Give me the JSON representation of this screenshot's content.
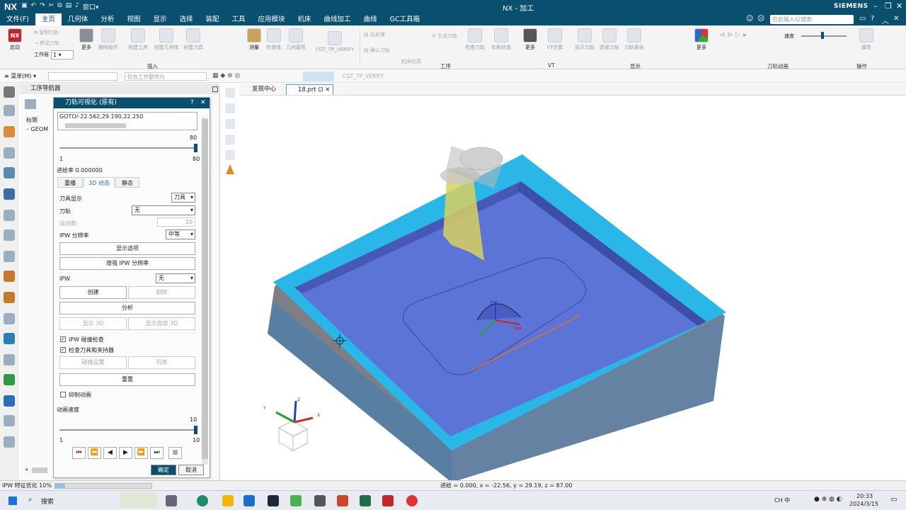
{
  "app": {
    "title": "NX - 加工",
    "logo": "NX",
    "brand": "SIEMENS",
    "quick_window": "窗口"
  },
  "menu": {
    "items": [
      "文件(F)",
      "主页",
      "几何体",
      "分析",
      "视图",
      "显示",
      "选择",
      "装配",
      "工具",
      "应用模块",
      "机床",
      "曲线加工",
      "曲线",
      "GC工具箱"
    ],
    "active": "主页",
    "search_placeholder": "在此输入以搜索"
  },
  "ribbon": {
    "start_label": "启动",
    "more_label": "更多",
    "workpiece_label": "工作层",
    "workpiece_value": "1",
    "insert_small": [
      "复制刀轨",
      "移动刀轨"
    ],
    "insert_buttons": [
      "删除组件",
      "创建工序",
      "创建几何体",
      "创建刀具",
      "测量",
      "检查体",
      "几何属性",
      "CGT_TP_VERIFY"
    ],
    "op_small": [
      "后处理",
      "确认刀轨",
      "机床仿真",
      "生成刀轨"
    ],
    "op_buttons": [
      "检查刀轨",
      "车削状态"
    ],
    "vt_label": "VT仿真",
    "display_buttons": [
      "显示刀轨",
      "选择刀轨",
      "刀轨报告"
    ],
    "speed_label": "速度",
    "property_label": "属性",
    "groups": [
      "插入",
      "工序",
      "VT",
      "显示",
      "刀轨动画",
      "操作"
    ]
  },
  "toolbar2": {
    "menu_label": "菜单(M)",
    "filter_placeholder": "仅在工作部件内",
    "verify_label": "CGT_TP_VERIFY"
  },
  "navigator": {
    "title": "工序导航器",
    "col_header": "标题",
    "root": "GEOM"
  },
  "dialog": {
    "title": "刀轨可视化 (原有)",
    "goto_line": "GOTO/-22.562,29.190,22.250",
    "slider_max": "80",
    "slider_min": "1",
    "slider_right": "80",
    "slider_value": 1.0,
    "feed_rate": "进给率 0.000000",
    "tabs": [
      "重播",
      "3D 动态",
      "静态"
    ],
    "active_tab": "3D 动态",
    "tool_display_label": "刀具显示",
    "tool_display_value": "刀具",
    "toolpath_label": "刀轨",
    "toolpath_value": "无",
    "motion_label": "运动数",
    "motion_value": "10",
    "ipw_res_label": "IPW 分辨率",
    "ipw_res_value": "中等",
    "btn_display_options": "显示选项",
    "btn_enhance_ipw": "增强 IPW 分辨率",
    "ipw_label": "IPW",
    "ipw_value": "无",
    "btn_create": "创建",
    "btn_delete": "删除",
    "btn_analyze": "分析",
    "btn_show3d": "显示 3D",
    "btn_show_custom3d": "显示自旋 3D",
    "cb_collision": "IPW 碰撞检查",
    "cb_check_tool": "检查刀具和夹持器",
    "btn_collision_settings": "碰撞设置",
    "btn_list": "列表",
    "btn_reset": "重置",
    "cb_suppress": "抑制动画",
    "anim_speed_label": "动画速度",
    "speed_max": "10",
    "speed_min": "1",
    "speed_right": "10",
    "speed_value": 1.0,
    "ok": "确定",
    "cancel": "取消"
  },
  "viewport": {
    "tabs": [
      "发现中心",
      "18.prt"
    ],
    "active_tab": "18.prt",
    "triad": {
      "x": "X",
      "y": "Y",
      "z": "Z"
    },
    "csys": {
      "zm": "ZM",
      "xm": "XM"
    }
  },
  "statusbar": {
    "left": "IPW 特征优化 10%",
    "right": "进给 = 0.000, x = -22.56, y = 29.19, z = 87.00",
    "progress": 0.1
  },
  "taskbar": {
    "search": "搜索",
    "ime": "中",
    "time": "20:33",
    "date": "2024/3/15"
  },
  "colors": {
    "accent": "#0a4f6e",
    "part_blue": "#5b74d6",
    "cyan_edge": "#2bb6e8",
    "tool_yellow": "#d8d060"
  }
}
